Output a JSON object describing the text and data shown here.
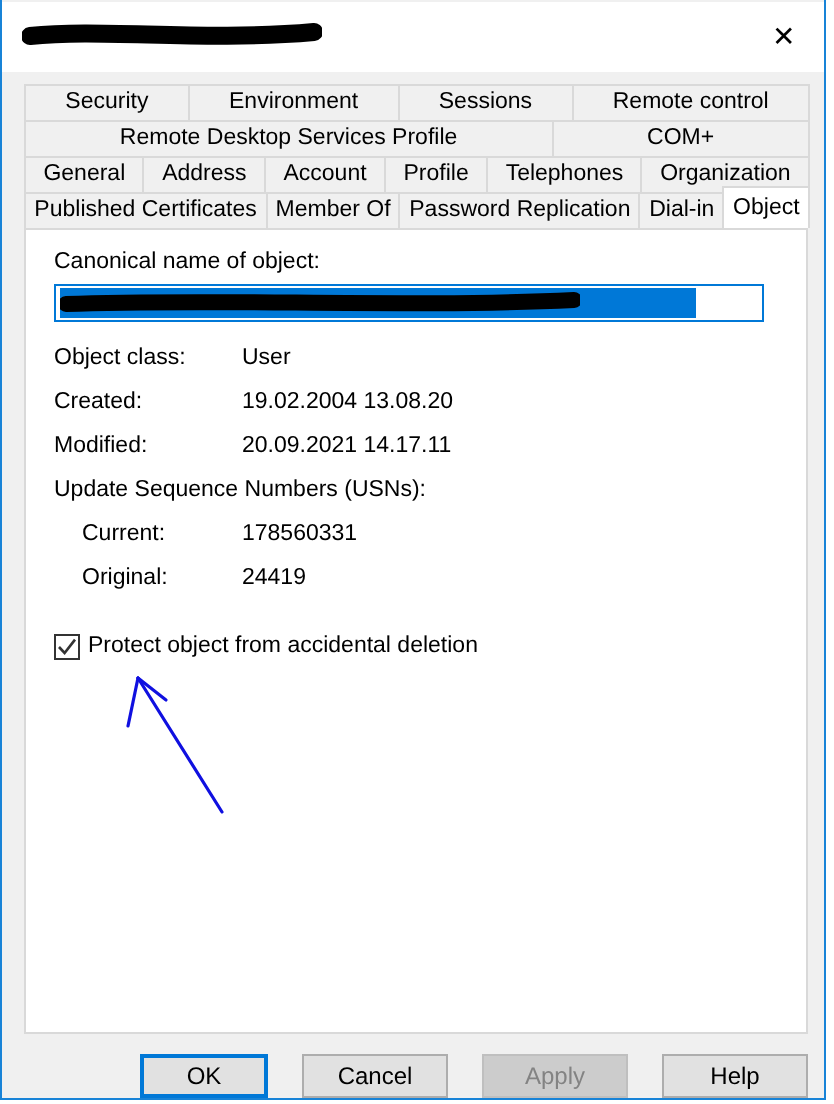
{
  "window": {
    "close": "✕"
  },
  "tab_rows": [
    [
      {
        "label": "Security",
        "selected": false
      },
      {
        "label": "Environment",
        "selected": false
      },
      {
        "label": "Sessions",
        "selected": false
      },
      {
        "label": "Remote control",
        "selected": false
      }
    ],
    [
      {
        "label": "Remote Desktop Services Profile",
        "selected": false
      },
      {
        "label": "COM+",
        "selected": false
      }
    ],
    [
      {
        "label": "General",
        "selected": false
      },
      {
        "label": "Address",
        "selected": false
      },
      {
        "label": "Account",
        "selected": false
      },
      {
        "label": "Profile",
        "selected": false
      },
      {
        "label": "Telephones",
        "selected": false
      },
      {
        "label": "Organization",
        "selected": false
      }
    ],
    [
      {
        "label": "Published Certificates",
        "selected": false
      },
      {
        "label": "Member Of",
        "selected": false
      },
      {
        "label": "Password Replication",
        "selected": false
      },
      {
        "label": "Dial-in",
        "selected": false
      },
      {
        "label": "Object",
        "selected": true
      }
    ]
  ],
  "canonical_name": {
    "label": "Canonical name of object:"
  },
  "properties": [
    {
      "label": "Object class:",
      "value": "User"
    },
    {
      "label": "Created:",
      "value": "19.02.2004 13.08.20"
    },
    {
      "label": "Modified:",
      "value": "20.09.2021 14.17.11"
    }
  ],
  "usn": {
    "label": "Update Sequence Numbers (USNs):",
    "rows": [
      {
        "label": "Current:",
        "value": "178560331"
      },
      {
        "label": "Original:",
        "value": "24419"
      }
    ]
  },
  "protect": {
    "label": "Protect object from accidental deletion",
    "checked": true
  },
  "buttons": [
    {
      "label": "OK",
      "kind": "default"
    },
    {
      "label": "Cancel",
      "kind": "normal"
    },
    {
      "label": "Apply",
      "kind": "disabled"
    },
    {
      "label": "Help",
      "kind": "normal"
    }
  ]
}
